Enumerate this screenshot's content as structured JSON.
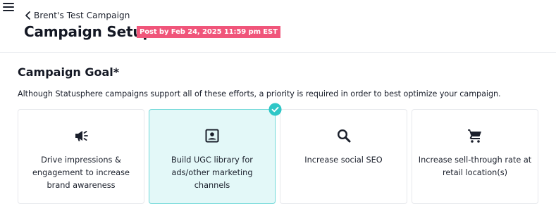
{
  "header": {
    "menu_icon": "hamburger-menu-icon",
    "back_icon": "chevron-left-icon",
    "breadcrumb": "Brent's Test Campaign",
    "page_title": "Campaign Setup",
    "deadline_badge": "Post by Feb 24, 2025 11:59 pm EST",
    "badge_color": "#f0557a"
  },
  "section": {
    "title": "Campaign Goal*",
    "description": "Although Statusphere campaigns support all of these efforts, a priority is required in order to best optimize your campaign."
  },
  "goals": [
    {
      "label": "Drive impressions & engagement to increase brand awareness",
      "icon": "megaphone-icon",
      "selected": false
    },
    {
      "label": "Build UGC library for ads/other marketing channels",
      "icon": "portrait-icon",
      "selected": true
    },
    {
      "label": "Increase social SEO",
      "icon": "search-icon",
      "selected": false
    },
    {
      "label": "Increase sell-through rate at retail location(s)",
      "icon": "shopping-cart-icon",
      "selected": false
    }
  ],
  "colors": {
    "selected_bg": "#e3f8f8",
    "selected_border": "#6fd8d8",
    "check_badge": "#2fc7c7"
  }
}
